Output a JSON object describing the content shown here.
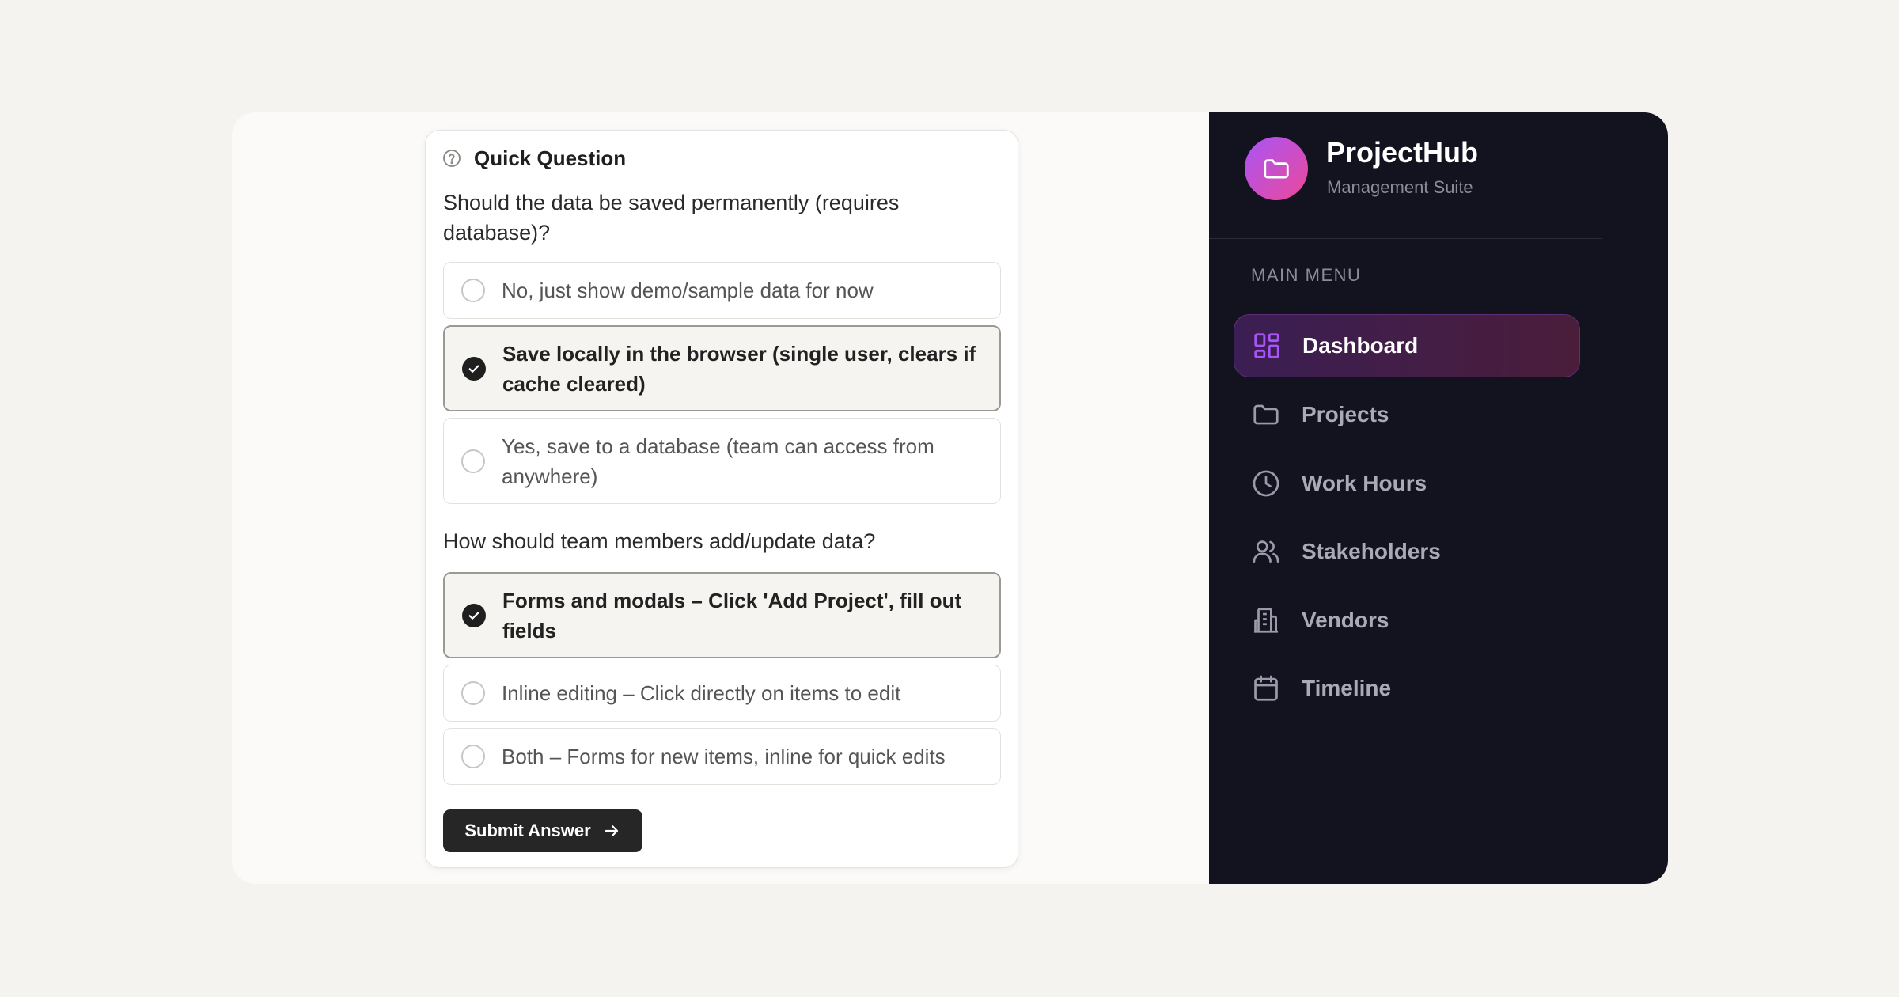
{
  "card": {
    "title": "Quick Question",
    "q1": {
      "text": "Should the data be saved permanently (requires database)?",
      "options": [
        {
          "label": "No, just show demo/sample data for now",
          "selected": false
        },
        {
          "label": "Save locally in the browser (single user, clears if cache cleared)",
          "selected": true
        },
        {
          "label": "Yes, save to a database (team can access from anywhere)",
          "selected": false
        }
      ]
    },
    "q2": {
      "text": "How should team members add/update data?",
      "options": [
        {
          "label": "Forms and modals – Click 'Add Project', fill out fields",
          "selected": true
        },
        {
          "label": "Inline editing – Click directly on items to edit",
          "selected": false
        },
        {
          "label": "Both – Forms for new items, inline for quick edits",
          "selected": false
        }
      ]
    },
    "submit_label": "Submit Answer"
  },
  "sidebar": {
    "brand": "ProjectHub",
    "subtitle": "Management Suite",
    "menu_heading": "MAIN MENU",
    "items": [
      {
        "label": "Dashboard",
        "icon": "dashboard-icon",
        "active": true
      },
      {
        "label": "Projects",
        "icon": "folder-icon",
        "active": false
      },
      {
        "label": "Work Hours",
        "icon": "clock-icon",
        "active": false
      },
      {
        "label": "Stakeholders",
        "icon": "users-icon",
        "active": false
      },
      {
        "label": "Vendors",
        "icon": "building-icon",
        "active": false
      },
      {
        "label": "Timeline",
        "icon": "calendar-icon",
        "active": false
      }
    ]
  },
  "colors": {
    "page_bg": "#f4f3f0",
    "sidebar_bg": "#13131f",
    "accent_purple": "#a855f7",
    "accent_pink": "#ec4899",
    "button_dark": "#262626"
  }
}
